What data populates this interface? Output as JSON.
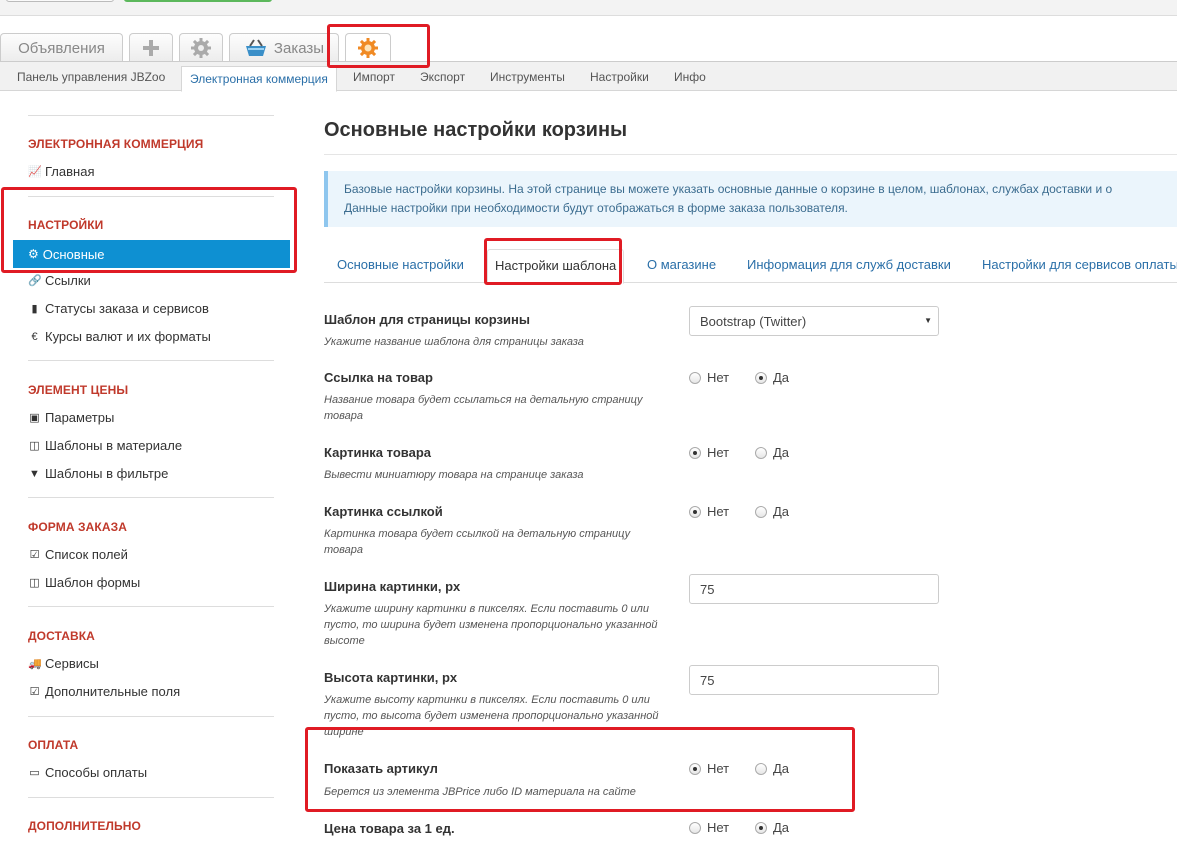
{
  "component_tabs": {
    "ads": "Объявления",
    "add_icon": "plus-icon",
    "settings_icon": "gear-icon",
    "orders": "Заказы",
    "orders_icon": "basket-icon",
    "jbzoo_icon": "jbzoo-gear-icon"
  },
  "submenu": [
    "Панель управления JBZoo",
    "Электронная коммерция",
    "Импорт",
    "Экспорт",
    "Инструменты",
    "Настройки",
    "Инфо"
  ],
  "sidebar": {
    "sections": [
      {
        "title": "ЭЛЕКТРОННАЯ КОММЕРЦИЯ",
        "items": [
          {
            "icon": "chart-icon",
            "label": "Главная"
          }
        ]
      },
      {
        "title": "НАСТРОЙКИ",
        "items": [
          {
            "icon": "gear-icon",
            "label": "Основные",
            "active": true
          },
          {
            "icon": "link-icon",
            "label": "Ссылки"
          },
          {
            "icon": "bookmark-icon",
            "label": "Статусы заказа и сервисов"
          },
          {
            "icon": "euro-icon",
            "label": "Курсы валют и их форматы"
          }
        ]
      },
      {
        "title": "ЭЛЕМЕНТ ЦЕНЫ",
        "items": [
          {
            "icon": "money-icon",
            "label": "Параметры"
          },
          {
            "icon": "columns-icon",
            "label": "Шаблоны в материале"
          },
          {
            "icon": "filter-icon",
            "label": "Шаблоны в фильтре"
          }
        ]
      },
      {
        "title": "ФОРМА ЗАКАЗА",
        "items": [
          {
            "icon": "checkbox-icon",
            "label": "Список полей"
          },
          {
            "icon": "columns-icon",
            "label": "Шаблон формы"
          }
        ]
      },
      {
        "title": "ДОСТАВКА",
        "items": [
          {
            "icon": "truck-icon",
            "label": "Сервисы"
          },
          {
            "icon": "checkbox-icon",
            "label": "Дополнительные поля"
          }
        ]
      },
      {
        "title": "ОПЛАТА",
        "items": [
          {
            "icon": "credit-card-icon",
            "label": "Способы оплаты"
          }
        ]
      },
      {
        "title": "ДОПОЛНИТЕЛЬНО",
        "items": []
      }
    ]
  },
  "main": {
    "title": "Основные настройки корзины",
    "info_line1": "Базовые настройки корзины. На этой странице вы можете указать основные данные о корзине в целом, шаблонах, службах доставки и о",
    "info_line2": "Данные настройки при необходимости будут отображаться в форме заказа пользователя.",
    "tabs": [
      "Основные настройки",
      "Настройки шаблона",
      "О магазине",
      "Информация для служб доставки",
      "Настройки для сервисов оплаты"
    ],
    "radio_no": "Нет",
    "radio_yes": "Да",
    "fields": {
      "template": {
        "label": "Шаблон для страницы корзины",
        "desc": "Укажите название шаблона для страницы заказа",
        "value": "Bootstrap (Twitter)"
      },
      "product_link": {
        "label": "Ссылка на товар",
        "desc": "Название товара будет ссылаться на детальную страницу товара",
        "selected": "Да"
      },
      "product_image": {
        "label": "Картинка товара",
        "desc": "Вывести миниатюру товара на странице заказа",
        "selected": "Нет"
      },
      "image_link": {
        "label": "Картинка ссылкой",
        "desc": "Картинка товара будет ссылкой на детальную страницу товара",
        "selected": "Нет"
      },
      "image_width": {
        "label": "Ширина картинки, px",
        "desc": "Укажите ширину картинки в пикселях. Если поставить 0 или пусто, то ширина будет изменена пропорционально указанной высоте",
        "value": "75"
      },
      "image_height": {
        "label": "Высота картинки, px",
        "desc": "Укажите высоту картинки в пикселях. Если поставить 0 или пусто, то высота будет изменена пропорционально указанной ширине",
        "value": "75"
      },
      "show_sku": {
        "label": "Показать артикул",
        "desc": "Берется из элемента JBPrice либо ID материала на сайте",
        "selected": "Нет"
      },
      "unit_price": {
        "label": "Цена товара за 1 ед.",
        "selected": "Да"
      }
    }
  }
}
